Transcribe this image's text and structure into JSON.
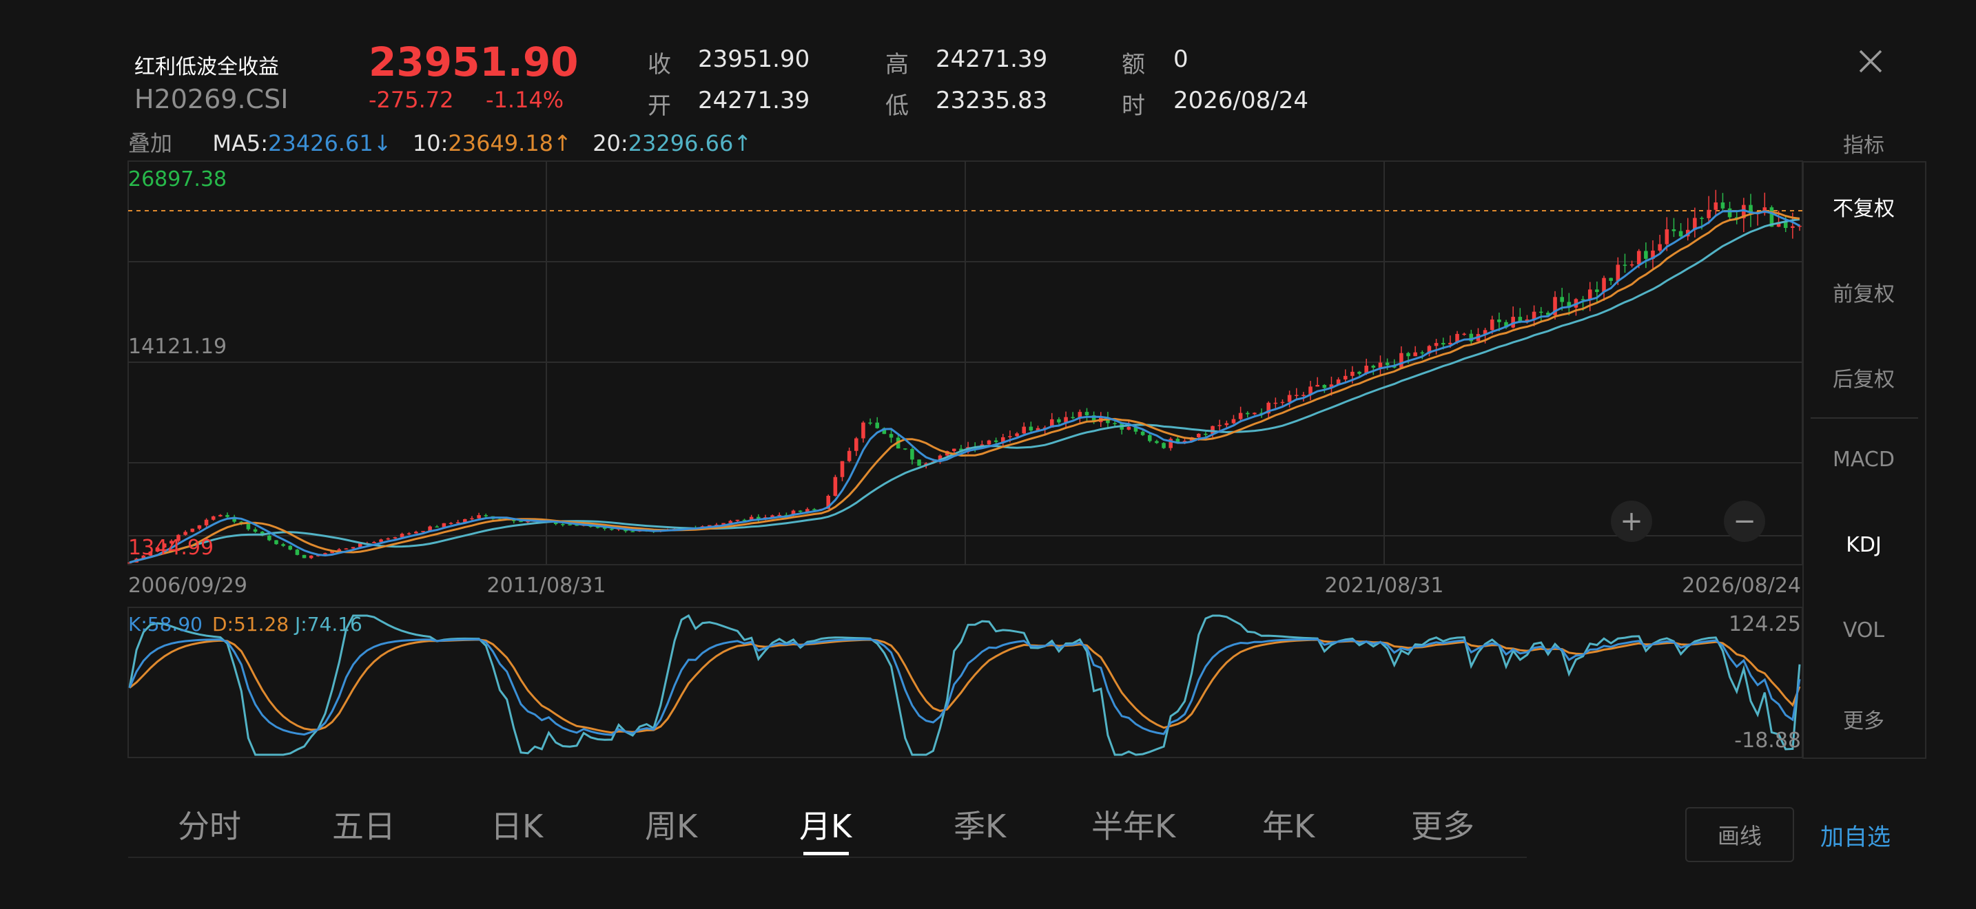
{
  "header": {
    "name": "红利低波全收益",
    "code": "H20269.CSI",
    "price": "23951.90",
    "change": "-275.72",
    "change_pct": "-1.14%",
    "close_label": "收",
    "close_value": "23951.90",
    "open_label": "开",
    "open_value": "24271.39",
    "high_label": "高",
    "high_value": "24271.39",
    "low_label": "低",
    "low_value": "23235.83",
    "amount_label": "额",
    "amount_value": "0",
    "time_label": "时",
    "time_value": "2026/08/24"
  },
  "ma_row": {
    "overlay_label": "叠加",
    "ma5_label": "MA5",
    "ma5_value": "23426.61",
    "ma5_arrow": "↓",
    "ma10_label": "10",
    "ma10_value": "23649.18",
    "ma10_arrow": "↑",
    "ma20_label": "20",
    "ma20_value": "23296.66",
    "ma20_arrow": "↑",
    "indicator_label": "指标"
  },
  "main_chart": {
    "top_value": "26897.38",
    "mid_value": "14121.19",
    "bottom_value": "1344.99",
    "dates": [
      "2006/09/29",
      "2011/08/31",
      "2021/08/31",
      "2026/08/24"
    ],
    "zoom_in": "+",
    "zoom_out": "−"
  },
  "kdj": {
    "k_label": "K:58.90",
    "d_label": "D:51.28",
    "j_label": "J:74.16",
    "top_value": "124.25",
    "bottom_value": "-18.88"
  },
  "side_menu": [
    "不复权",
    "前复权",
    "后复权",
    "MACD",
    "KDJ",
    "VOL",
    "更多"
  ],
  "periods": [
    "分时",
    "五日",
    "日K",
    "周K",
    "月K",
    "季K",
    "半年K",
    "年K",
    "更多"
  ],
  "actions": {
    "draw": "画线",
    "add_watch": "加自选"
  },
  "colors": {
    "up": "#f23d3d",
    "down": "#27b84a",
    "ma5": "#3a8fd6",
    "ma10": "#e08a2e",
    "ma20": "#52b3c6",
    "bg": "#141414",
    "grid": "#2c2c2c"
  },
  "chart_data": {
    "type": "candlestick",
    "title": "红利低波全收益 H20269.CSI",
    "x_range": [
      "2006/09/29",
      "2026/08/24"
    ],
    "ylim": [
      1344.99,
      26897.38
    ],
    "anchors": [
      {
        "date": "2006/09/29",
        "close": 1400
      },
      {
        "date": "2007/10/31",
        "close": 4700
      },
      {
        "date": "2008/10/31",
        "close": 1700
      },
      {
        "date": "2010/11/30",
        "close": 4500
      },
      {
        "date": "2012/12/31",
        "close": 3400
      },
      {
        "date": "2014/12/31",
        "close": 5000
      },
      {
        "date": "2015/06/30",
        "close": 11000
      },
      {
        "date": "2016/02/29",
        "close": 8100
      },
      {
        "date": "2018/01/31",
        "close": 11500
      },
      {
        "date": "2019/01/31",
        "close": 9300
      },
      {
        "date": "2021/08/31",
        "close": 14500
      },
      {
        "date": "2024/02/29",
        "close": 19500
      },
      {
        "date": "2025/08/29",
        "close": 25500
      },
      {
        "date": "2026/08/24",
        "close": 23951.9
      }
    ],
    "kdj_last": {
      "K": 58.9,
      "D": 51.28,
      "J": 74.16
    },
    "kdj_range": [
      -18.88,
      124.25
    ]
  }
}
